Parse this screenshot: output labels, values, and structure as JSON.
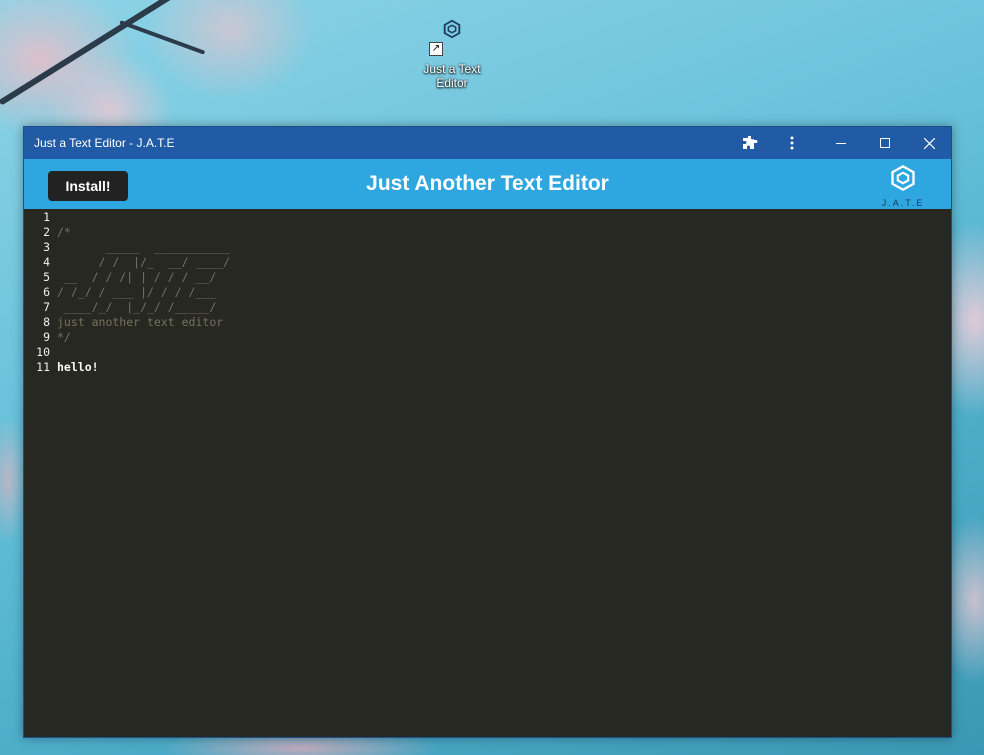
{
  "desktop": {
    "icon_label": "Just a Text\nEditor",
    "icon_brand": "J.A.T.E"
  },
  "window": {
    "title": "Just a Text Editor - J.A.T.E",
    "extensions_icon": "puzzle-icon",
    "menu_icon": "more-vertical-icon",
    "minimize_icon": "minimize-icon",
    "maximize_icon": "maximize-icon",
    "close_icon": "close-icon"
  },
  "app": {
    "install_label": "Install!",
    "title": "Just Another Text Editor",
    "logo_text": "J.A.T.E"
  },
  "editor": {
    "lines": [
      {
        "n": "1",
        "text": ""
      },
      {
        "n": "2",
        "text": "/*"
      },
      {
        "n": "3",
        "text": "       _____  ___________"
      },
      {
        "n": "4",
        "text": "      / /  |/_  __/ ____/"
      },
      {
        "n": "5",
        "text": " __  / / /| | / / / __/"
      },
      {
        "n": "6",
        "text": "/ /_/ / ___ |/ / / /___"
      },
      {
        "n": "7",
        "text": " ____/_/  |_/_/ /_____/"
      },
      {
        "n": "8",
        "text": "just another text editor"
      },
      {
        "n": "9",
        "text": "*/"
      },
      {
        "n": "10",
        "text": ""
      },
      {
        "n": "11",
        "text": "hello!"
      }
    ]
  },
  "colors": {
    "titlebar": "#215ba6",
    "appbar": "#2ea6df",
    "editor_bg": "#272822",
    "comment": "#75715e",
    "text": "#f8f8f2"
  }
}
